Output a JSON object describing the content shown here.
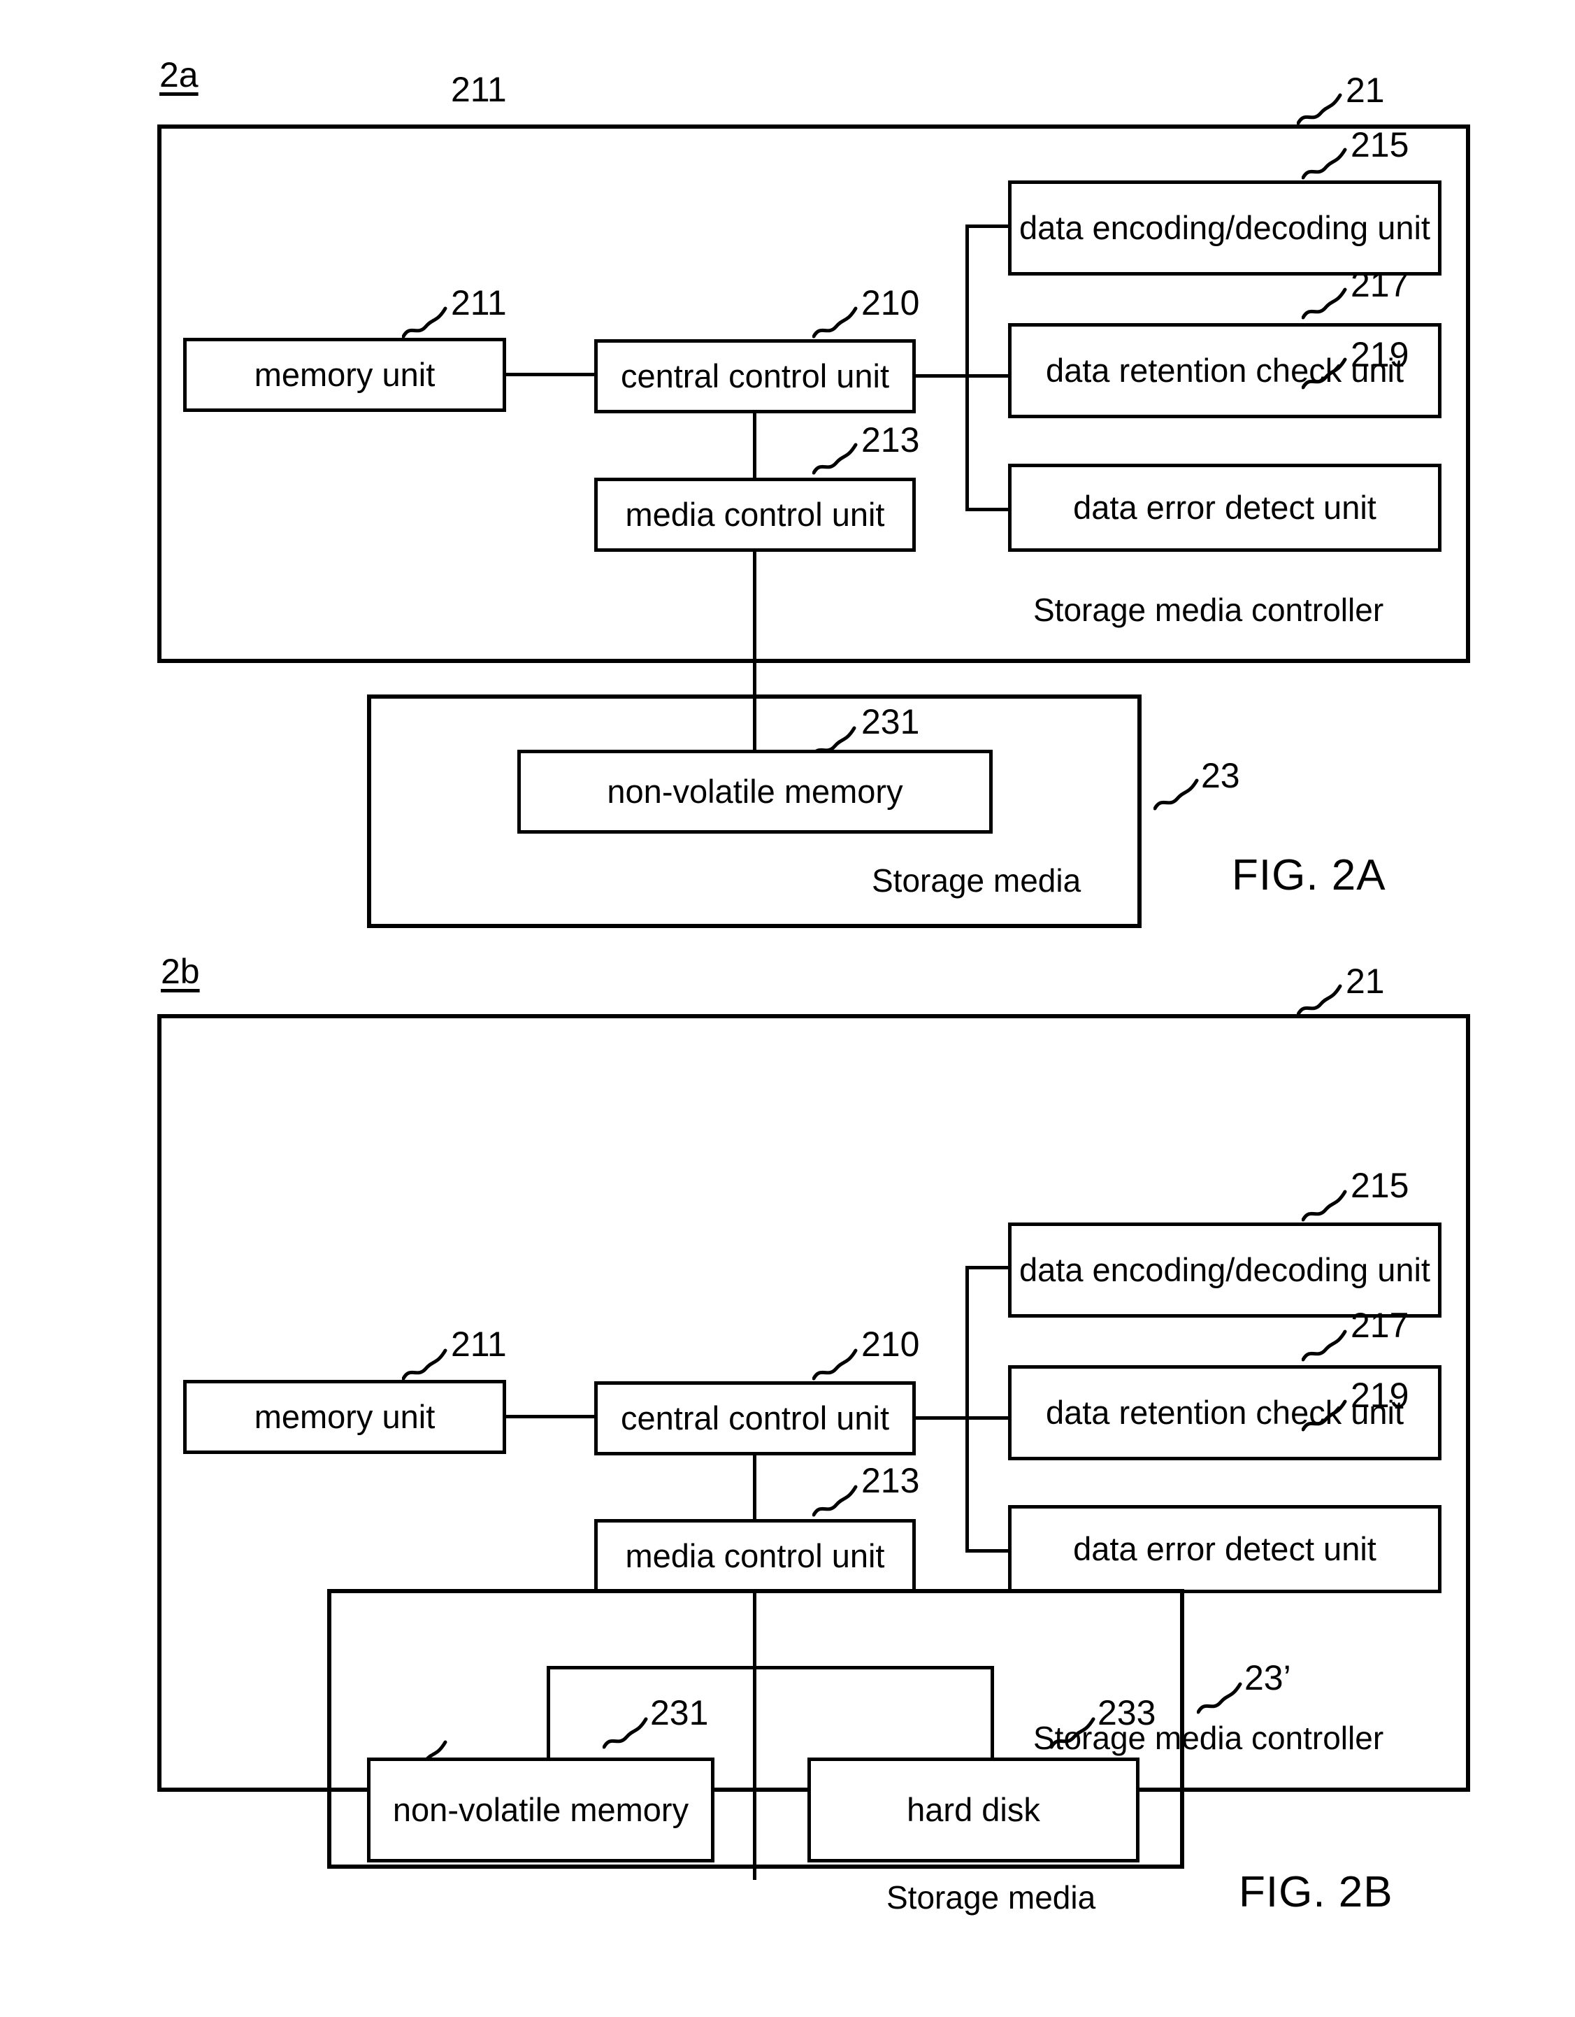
{
  "figures": [
    {
      "sheet_label": "2a",
      "fig_title": "FIG. 2A",
      "controller": {
        "ref": "21",
        "caption": "Storage media controller",
        "blocks": [
          {
            "ref": "211",
            "label": "memory unit"
          },
          {
            "ref": "210",
            "label": "central control unit"
          },
          {
            "ref": "213",
            "label": "media control unit"
          },
          {
            "ref": "215",
            "label": "data encoding/decoding unit"
          },
          {
            "ref": "217",
            "label": "data retention check unit"
          },
          {
            "ref": "219",
            "label": "data error detect unit"
          }
        ]
      },
      "storage_media": {
        "ref": "23",
        "caption": "Storage media",
        "blocks": [
          {
            "ref": "231",
            "label": "non-volatile memory"
          }
        ]
      }
    },
    {
      "sheet_label": "2b",
      "fig_title": "FIG. 2B",
      "controller": {
        "ref": "21",
        "caption": "Storage media controller",
        "blocks": [
          {
            "ref": "211",
            "label": "memory unit"
          },
          {
            "ref": "210",
            "label": "central control unit"
          },
          {
            "ref": "213",
            "label": "media control unit"
          },
          {
            "ref": "215",
            "label": "data encoding/decoding unit"
          },
          {
            "ref": "217",
            "label": "data retention check unit"
          },
          {
            "ref": "219",
            "label": "data error detect unit"
          }
        ]
      },
      "storage_media": {
        "ref": "23’",
        "caption": "Storage media",
        "blocks": [
          {
            "ref": "231",
            "label": "non-volatile memory"
          },
          {
            "ref": "233",
            "label": "hard disk"
          }
        ]
      }
    }
  ],
  "colors": {
    "ink": "#000000",
    "paper": "#ffffff"
  }
}
